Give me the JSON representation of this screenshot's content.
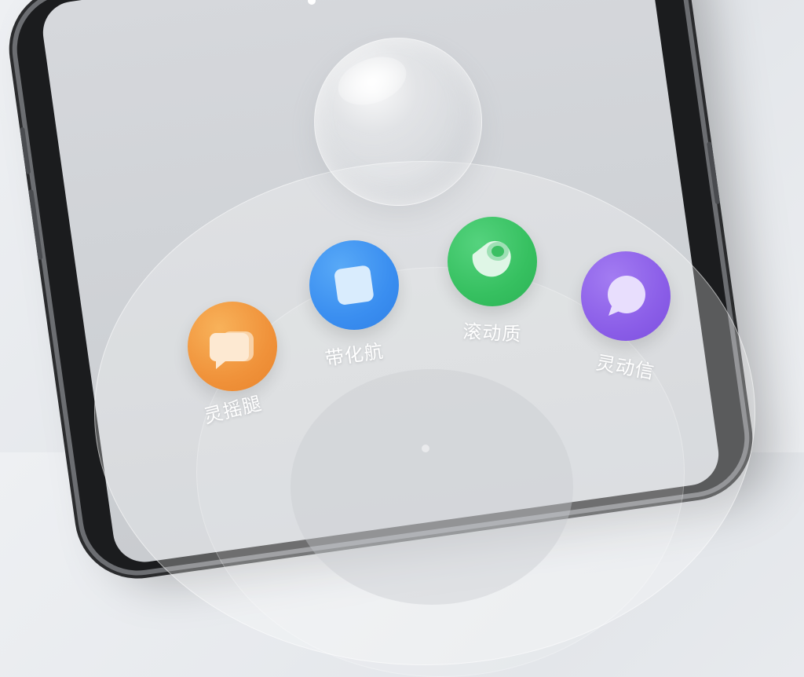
{
  "apps": [
    {
      "label": "灵摇腿",
      "icon": "chat-bubble-icon",
      "color": "#f29a3a"
    },
    {
      "label": "带化航",
      "icon": "square-tile-icon",
      "color": "#3f93f0"
    },
    {
      "label": "滚动质",
      "icon": "toggle-ring-icon",
      "color": "#3dc46a"
    },
    {
      "label": "灵动信",
      "icon": "message-bubble-icon",
      "color": "#8a5ce6"
    }
  ]
}
